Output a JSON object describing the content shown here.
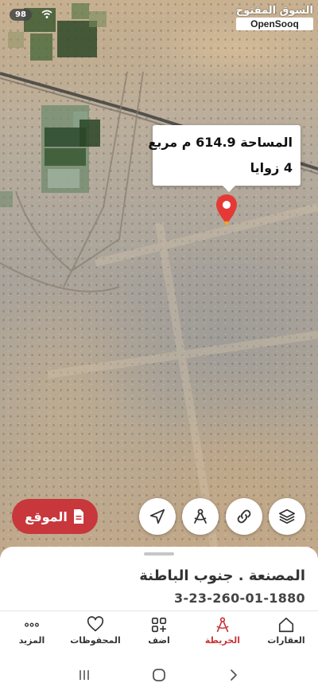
{
  "status": {
    "battery": "98"
  },
  "watermark": {
    "arabic": "السوق المفتوح",
    "brand": "OpenSooq"
  },
  "map": {
    "bubble": {
      "area_line": "المساحة 614.9 م مربع",
      "corners_line": "4 زوايا"
    },
    "controls": [
      {
        "name": "layers-icon"
      },
      {
        "name": "link-icon"
      },
      {
        "name": "measure-icon"
      },
      {
        "name": "navigation-arrow-icon"
      }
    ],
    "location_button": {
      "label": "الموقع",
      "color": "#c8373b"
    }
  },
  "listing": {
    "title": "المصنعة . جنوب الباطنة",
    "plot_code": "3-23-260-01-1880"
  },
  "bottom_nav": {
    "items": [
      {
        "label": "العقارات",
        "icon": "house-icon",
        "active": false
      },
      {
        "label": "الخريطة",
        "icon": "map-compass-icon",
        "active": true
      },
      {
        "label": "اضف",
        "icon": "add-grid-icon",
        "active": false
      },
      {
        "label": "المحفوظات",
        "icon": "heart-icon",
        "active": false
      },
      {
        "label": "المزيد",
        "icon": "more-dots-icon",
        "active": false
      }
    ]
  },
  "colors": {
    "accent": "#c8373b",
    "text": "#333333"
  }
}
